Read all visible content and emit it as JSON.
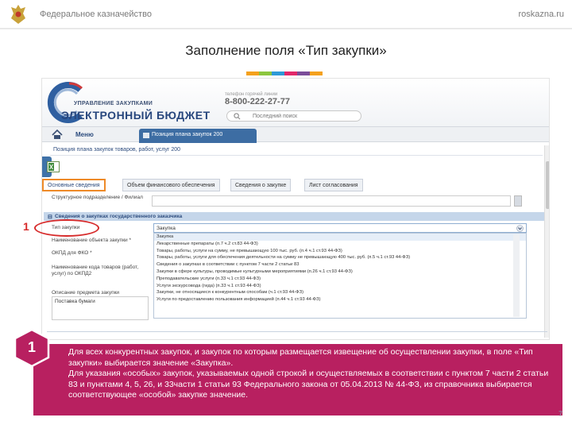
{
  "slide": {
    "org_name": "Федеральное казначейство",
    "site_url": "roskazna.ru",
    "title": "Заполнение поля «Тип закупки»",
    "color_strip": [
      "#f4a11d",
      "#8cc63e",
      "#2e9ad7",
      "#e3286a",
      "#7b4c99",
      "#f4a11d"
    ],
    "page_number": "7"
  },
  "app": {
    "brand_sub": "УПРАВЛЕНИЕ ЗАКУПКАМИ",
    "brand_main": "ЭЛЕКТРОННЫЙ БЮДЖЕТ",
    "hotline_label": "телефон горячей линии",
    "hotline_phone": "8-800-222-27-77",
    "search_placeholder": "Последний поиск",
    "menu_label": "Меню",
    "open_tab_label": "Позиция плана закупок 200",
    "doc_title": "Позиция плана закупок товаров, работ, услуг 200",
    "tabs": [
      "Основные сведения",
      "Объем финансового обеспечения",
      "Сведения о закупке",
      "Лист согласования"
    ],
    "fields": {
      "structure_unit": "Структурное подразделение / Филиал",
      "section_title": "Сведения о закупках государственного заказчика",
      "purchase_type": "Тип закупки",
      "object_name": "Наименование объекта закупки *",
      "okpd": "ОКПД для ФКО *",
      "plan_code": "Наименование кода товаров (работ, услуг) по ОКПД2",
      "description": "Описание предмета закупки",
      "textarea_value": "Поставка бумаги"
    },
    "purchase_type_value": "Закупка",
    "dropdown_options": [
      "Закупка",
      "Лекарственные препараты (п.7 ч.2 ст.83 44-ФЗ)",
      "Товары, работы, услуги на сумму, не превышающую 100 тыс. руб. (п.4 ч.1 ст.93 44-ФЗ)",
      "Товары, работы, услуги для обеспечения деятельности на сумму не превышающую 400 тыс. руб. (п.5 ч.1 ст.93 44-ФЗ)",
      "Сведения о закупках в соответствии с пунктом 7 части 2 статьи 83",
      "Закупки в сфере культуры, проводимые культурными мероприятиями (п.26 ч.1 ст.93 44-ФЗ)",
      "Преподавательские услуги (п.33 ч.1 ст.93 44-ФЗ)",
      "Услуги экскурсовода (гида) (п.33 ч.1 ст.93 44-ФЗ)",
      "Закупки, не относящиеся к конкурентным способам (ч.1 ст.93 44-ФЗ)",
      "Услуги по предоставлению пользования информацией (п.44 ч.1 ст.93 44-ФЗ)"
    ]
  },
  "annotation": {
    "callout_number": "1"
  },
  "note": {
    "badge": "1",
    "line1": "Для всех конкурентных закупок, и закупок по которым размещается извещение об осуществлении закупки, в поле «Тип закупки» выбирается значение «Закупка».",
    "line2": "Для указания «особых» закупок, указываемых одной строкой и осуществляемых в соответствии с пунктом 7 части 2 статьи 83 и пунктами 4, 5, 26, и 33части 1 статьи 93 Федерального закона от 05.04.2013 № 44-ФЗ, из справочника выбирается соответствующее «особой» закупке значение."
  }
}
